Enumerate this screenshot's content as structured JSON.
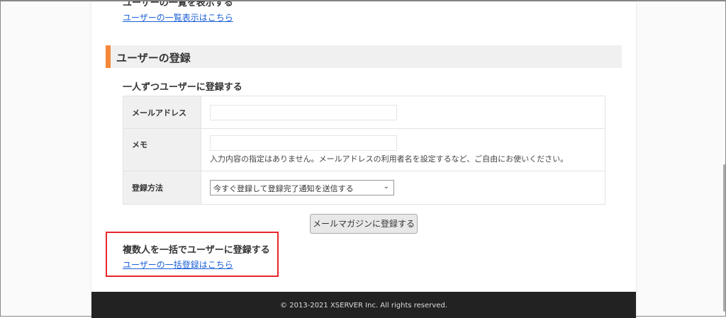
{
  "top_heading_partial": "ユーザーの一覧を表示する",
  "list_link": "ユーザーの一覧表示はこちら",
  "section_title": "ユーザーの登録",
  "single_heading": "一人ずつユーザーに登録する",
  "form": {
    "email_label": "メールアドレス",
    "email_value": "",
    "memo_label": "メモ",
    "memo_value": "",
    "memo_note": "入力内容の指定はありません。メールアドレスの利用者名を設定するなど、ご自由にお使いください。",
    "method_label": "登録方法",
    "method_selected": "今すぐ登録して登録完了通知を送信する"
  },
  "submit_label": "メールマガジンに登録する",
  "bulk_heading": "複数人を一括でユーザーに登録する",
  "bulk_link": "ユーザーの一括登録はこちら",
  "footer": "© 2013-2021 XSERVER Inc. All rights reserved.",
  "colors": {
    "accent": "#f5873a",
    "highlight": "#e8262a",
    "link": "#1a5fd6",
    "footer_bg": "#222222"
  }
}
